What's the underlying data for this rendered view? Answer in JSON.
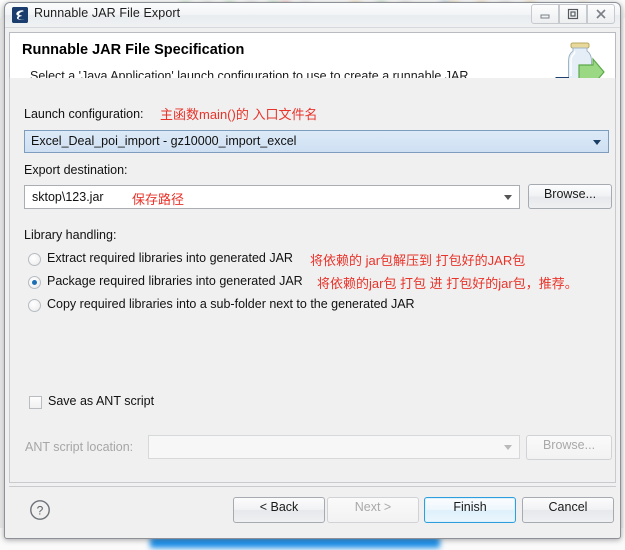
{
  "window": {
    "title": "Runnable JAR File Export",
    "icon": "eclipse-jar-icon",
    "controls": {
      "minimize": "minimize-icon",
      "maximize": "restore-icon",
      "close": "close-icon"
    }
  },
  "banner": {
    "title": "Runnable JAR File Specification",
    "description": "Select a 'Java Application' launch configuration to use to create a runnable JAR.",
    "icon": "jar-export-icon"
  },
  "form": {
    "launch_configuration": {
      "label": "Launch configuration:",
      "value": "Excel_Deal_poi_import - gz10000_import_excel",
      "annotation": "主函数main()的 入口文件名"
    },
    "export_destination": {
      "label": "Export destination:",
      "value": "sktop\\123.jar",
      "annotation": "保存路径",
      "browse_label": "Browse..."
    },
    "library_handling": {
      "label": "Library handling:",
      "options": [
        {
          "label": "Extract required libraries into generated JAR",
          "selected": false,
          "annotation": "将依赖的 jar包解压到 打包好的JAR包"
        },
        {
          "label": "Package required libraries into generated JAR",
          "selected": true,
          "annotation": "将依赖的jar包  打包 进 打包好的jar包，推荐。"
        },
        {
          "label": "Copy required libraries into a sub-folder next to the generated JAR",
          "selected": false,
          "annotation": ""
        }
      ]
    },
    "save_as_ant": {
      "label": "Save as ANT script",
      "checked": false
    },
    "ant_script_location": {
      "label": "ANT script location:",
      "value": "",
      "browse_label": "Browse...",
      "disabled": true
    }
  },
  "footer": {
    "help": "help-icon",
    "back_label": "< Back",
    "next_label": "Next >",
    "finish_label": "Finish",
    "cancel_label": "Cancel"
  },
  "colors": {
    "annotation_red": "#e8332a",
    "default_button_blue": "#2d9fdc",
    "combo_selected_blue": "#cfe0f3"
  }
}
